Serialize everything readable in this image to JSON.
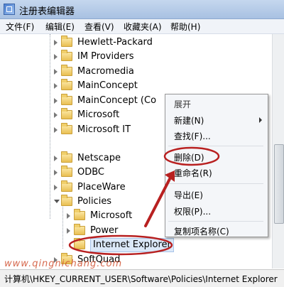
{
  "window": {
    "title": "注册表编辑器",
    "icon": "registry-editor-icon"
  },
  "menubar": {
    "items": [
      "文件(F)",
      "编辑(E)",
      "查看(V)",
      "收藏夹(A)",
      "帮助(H)"
    ]
  },
  "tree": {
    "items": [
      "Hewlett-Packard",
      "IM Providers",
      "Macromedia",
      "MainConcept",
      "MainConcept (Co",
      "Microsoft",
      "Microsoft IT",
      "Netscape",
      "ODBC",
      "PlaceWare",
      "Policies",
      "Microsoft",
      "Power",
      "Internet Explorer",
      "SoftQuad"
    ],
    "selected": "Internet Explorer"
  },
  "context_menu": {
    "items": [
      "展开",
      "新建(N)",
      "查找(F)...",
      "删除(D)",
      "重命名(R)",
      "导出(E)",
      "权限(P)...",
      "复制项名称(C)"
    ],
    "submenu_item": "新建(N)"
  },
  "statusbar": {
    "path": "计算机\\HKEY_CURRENT_USER\\Software\\Policies\\Internet Explorer"
  },
  "watermark": {
    "text": "www.qingnichang.com"
  },
  "colors": {
    "annotation": "#b82020",
    "selection": "#dbe8f8",
    "titlebar": "#b6cbe8"
  }
}
